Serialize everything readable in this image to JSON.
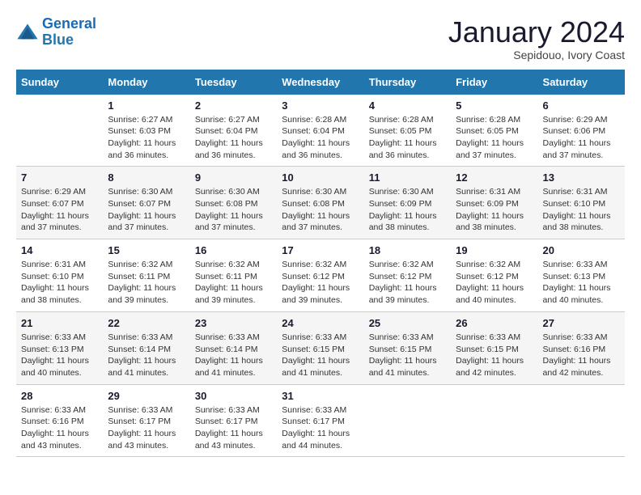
{
  "logo": {
    "line1": "General",
    "line2": "Blue"
  },
  "title": "January 2024",
  "subtitle": "Sepidouo, Ivory Coast",
  "header_days": [
    "Sunday",
    "Monday",
    "Tuesday",
    "Wednesday",
    "Thursday",
    "Friday",
    "Saturday"
  ],
  "weeks": [
    [
      {
        "day": "",
        "lines": []
      },
      {
        "day": "1",
        "lines": [
          "Sunrise: 6:27 AM",
          "Sunset: 6:03 PM",
          "Daylight: 11 hours",
          "and 36 minutes."
        ]
      },
      {
        "day": "2",
        "lines": [
          "Sunrise: 6:27 AM",
          "Sunset: 6:04 PM",
          "Daylight: 11 hours",
          "and 36 minutes."
        ]
      },
      {
        "day": "3",
        "lines": [
          "Sunrise: 6:28 AM",
          "Sunset: 6:04 PM",
          "Daylight: 11 hours",
          "and 36 minutes."
        ]
      },
      {
        "day": "4",
        "lines": [
          "Sunrise: 6:28 AM",
          "Sunset: 6:05 PM",
          "Daylight: 11 hours",
          "and 36 minutes."
        ]
      },
      {
        "day": "5",
        "lines": [
          "Sunrise: 6:28 AM",
          "Sunset: 6:05 PM",
          "Daylight: 11 hours",
          "and 37 minutes."
        ]
      },
      {
        "day": "6",
        "lines": [
          "Sunrise: 6:29 AM",
          "Sunset: 6:06 PM",
          "Daylight: 11 hours",
          "and 37 minutes."
        ]
      }
    ],
    [
      {
        "day": "7",
        "lines": [
          "Sunrise: 6:29 AM",
          "Sunset: 6:07 PM",
          "Daylight: 11 hours",
          "and 37 minutes."
        ]
      },
      {
        "day": "8",
        "lines": [
          "Sunrise: 6:30 AM",
          "Sunset: 6:07 PM",
          "Daylight: 11 hours",
          "and 37 minutes."
        ]
      },
      {
        "day": "9",
        "lines": [
          "Sunrise: 6:30 AM",
          "Sunset: 6:08 PM",
          "Daylight: 11 hours",
          "and 37 minutes."
        ]
      },
      {
        "day": "10",
        "lines": [
          "Sunrise: 6:30 AM",
          "Sunset: 6:08 PM",
          "Daylight: 11 hours",
          "and 37 minutes."
        ]
      },
      {
        "day": "11",
        "lines": [
          "Sunrise: 6:30 AM",
          "Sunset: 6:09 PM",
          "Daylight: 11 hours",
          "and 38 minutes."
        ]
      },
      {
        "day": "12",
        "lines": [
          "Sunrise: 6:31 AM",
          "Sunset: 6:09 PM",
          "Daylight: 11 hours",
          "and 38 minutes."
        ]
      },
      {
        "day": "13",
        "lines": [
          "Sunrise: 6:31 AM",
          "Sunset: 6:10 PM",
          "Daylight: 11 hours",
          "and 38 minutes."
        ]
      }
    ],
    [
      {
        "day": "14",
        "lines": [
          "Sunrise: 6:31 AM",
          "Sunset: 6:10 PM",
          "Daylight: 11 hours",
          "and 38 minutes."
        ]
      },
      {
        "day": "15",
        "lines": [
          "Sunrise: 6:32 AM",
          "Sunset: 6:11 PM",
          "Daylight: 11 hours",
          "and 39 minutes."
        ]
      },
      {
        "day": "16",
        "lines": [
          "Sunrise: 6:32 AM",
          "Sunset: 6:11 PM",
          "Daylight: 11 hours",
          "and 39 minutes."
        ]
      },
      {
        "day": "17",
        "lines": [
          "Sunrise: 6:32 AM",
          "Sunset: 6:12 PM",
          "Daylight: 11 hours",
          "and 39 minutes."
        ]
      },
      {
        "day": "18",
        "lines": [
          "Sunrise: 6:32 AM",
          "Sunset: 6:12 PM",
          "Daylight: 11 hours",
          "and 39 minutes."
        ]
      },
      {
        "day": "19",
        "lines": [
          "Sunrise: 6:32 AM",
          "Sunset: 6:12 PM",
          "Daylight: 11 hours",
          "and 40 minutes."
        ]
      },
      {
        "day": "20",
        "lines": [
          "Sunrise: 6:33 AM",
          "Sunset: 6:13 PM",
          "Daylight: 11 hours",
          "and 40 minutes."
        ]
      }
    ],
    [
      {
        "day": "21",
        "lines": [
          "Sunrise: 6:33 AM",
          "Sunset: 6:13 PM",
          "Daylight: 11 hours",
          "and 40 minutes."
        ]
      },
      {
        "day": "22",
        "lines": [
          "Sunrise: 6:33 AM",
          "Sunset: 6:14 PM",
          "Daylight: 11 hours",
          "and 41 minutes."
        ]
      },
      {
        "day": "23",
        "lines": [
          "Sunrise: 6:33 AM",
          "Sunset: 6:14 PM",
          "Daylight: 11 hours",
          "and 41 minutes."
        ]
      },
      {
        "day": "24",
        "lines": [
          "Sunrise: 6:33 AM",
          "Sunset: 6:15 PM",
          "Daylight: 11 hours",
          "and 41 minutes."
        ]
      },
      {
        "day": "25",
        "lines": [
          "Sunrise: 6:33 AM",
          "Sunset: 6:15 PM",
          "Daylight: 11 hours",
          "and 41 minutes."
        ]
      },
      {
        "day": "26",
        "lines": [
          "Sunrise: 6:33 AM",
          "Sunset: 6:15 PM",
          "Daylight: 11 hours",
          "and 42 minutes."
        ]
      },
      {
        "day": "27",
        "lines": [
          "Sunrise: 6:33 AM",
          "Sunset: 6:16 PM",
          "Daylight: 11 hours",
          "and 42 minutes."
        ]
      }
    ],
    [
      {
        "day": "28",
        "lines": [
          "Sunrise: 6:33 AM",
          "Sunset: 6:16 PM",
          "Daylight: 11 hours",
          "and 43 minutes."
        ]
      },
      {
        "day": "29",
        "lines": [
          "Sunrise: 6:33 AM",
          "Sunset: 6:17 PM",
          "Daylight: 11 hours",
          "and 43 minutes."
        ]
      },
      {
        "day": "30",
        "lines": [
          "Sunrise: 6:33 AM",
          "Sunset: 6:17 PM",
          "Daylight: 11 hours",
          "and 43 minutes."
        ]
      },
      {
        "day": "31",
        "lines": [
          "Sunrise: 6:33 AM",
          "Sunset: 6:17 PM",
          "Daylight: 11 hours",
          "and 44 minutes."
        ]
      },
      {
        "day": "",
        "lines": []
      },
      {
        "day": "",
        "lines": []
      },
      {
        "day": "",
        "lines": []
      }
    ]
  ]
}
